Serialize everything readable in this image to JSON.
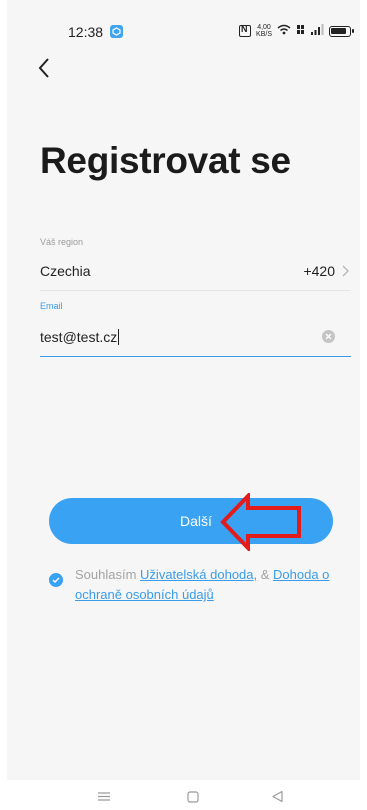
{
  "status_bar": {
    "time": "12:38",
    "speed_top": "4,00",
    "speed_bottom": "KB/S",
    "icons": [
      "app-notification-icon",
      "nfc-icon",
      "wifi-icon",
      "volte-icon",
      "signal-icon",
      "battery-icon"
    ]
  },
  "header": {
    "back_icon": "chevron-left-icon",
    "title": "Registrovat se"
  },
  "form": {
    "region_label": "Váš region",
    "region_value": "Czechia",
    "dial_code": "+420",
    "email_label": "Email",
    "email_value": "test@test.cz"
  },
  "next_button": {
    "label": "Další"
  },
  "consent": {
    "prefix": "Souhlasím ",
    "terms_link": "Uživatelská dohoda,",
    "separator": " & ",
    "privacy_link": "Dohoda o ochraně osobních údajů",
    "checked": true
  },
  "colors": {
    "accent": "#3aa2f3",
    "annotation_arrow": "#e31b1b",
    "background": "#f6f6f6"
  },
  "nav_bar": {
    "icons": [
      "menu-icon",
      "home-square-icon",
      "back-triangle-icon"
    ]
  }
}
